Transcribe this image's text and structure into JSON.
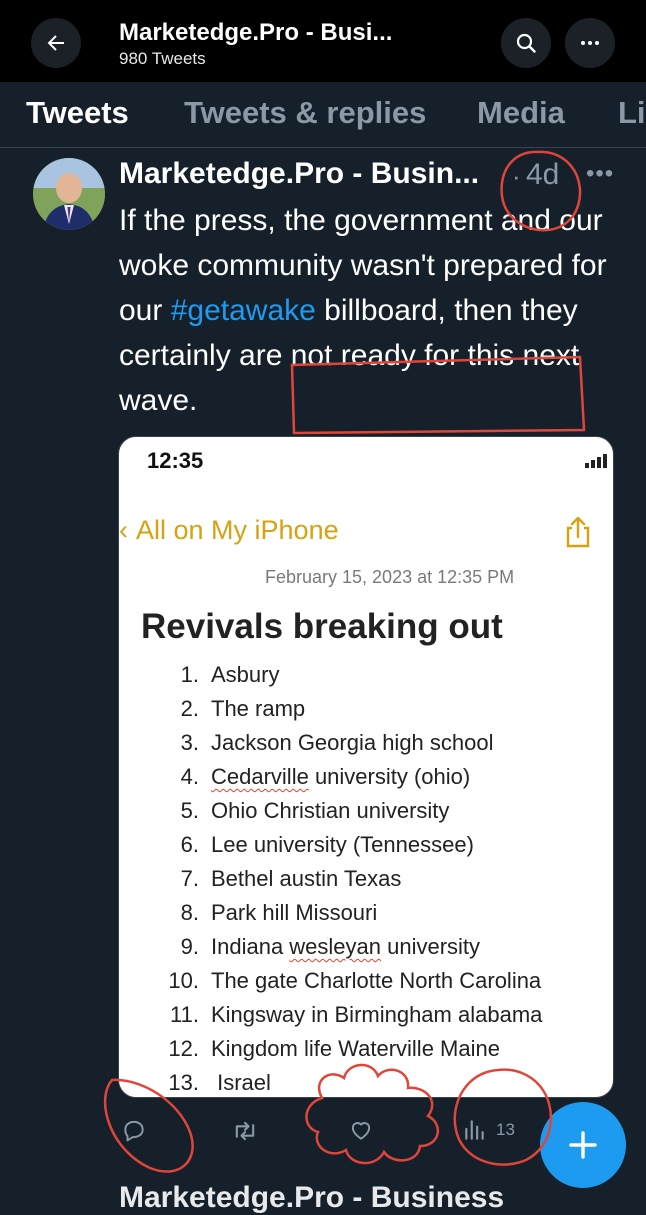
{
  "header": {
    "title": "Marketedge.Pro - Busi...",
    "subtitle": "980 Tweets"
  },
  "tabs": [
    {
      "label": "Tweets",
      "active": true
    },
    {
      "label": "Tweets & replies",
      "active": false
    },
    {
      "label": "Media",
      "active": false
    },
    {
      "label": "Li",
      "active": false
    }
  ],
  "tweet": {
    "author": "Marketedge.Pro - Busin...",
    "separator": "·",
    "time": "4d",
    "text_before": "If the press, the government and our woke community wasn't prepared for our ",
    "hashtag": "#getawake",
    "text_after": " billboard, then they certainly are not ready for this next wave.",
    "views": "13"
  },
  "media": {
    "status_time": "12:35",
    "back_label": "All on My iPhone",
    "date": "February 15, 2023 at 12:35 PM",
    "title": "Revivals breaking out",
    "items": [
      {
        "num": "1.",
        "text": "Asbury"
      },
      {
        "num": "2.",
        "text": "The ramp"
      },
      {
        "num": "3.",
        "text": "Jackson Georgia high school"
      },
      {
        "num": "4.",
        "pre": "",
        "squiggle": "Cedarville",
        "post": " university (ohio)"
      },
      {
        "num": "5.",
        "text": "Ohio Christian university"
      },
      {
        "num": "6.",
        "text": "Lee university (Tennessee)"
      },
      {
        "num": "7.",
        "text": "Bethel austin Texas"
      },
      {
        "num": "8.",
        "text": "Park hill Missouri"
      },
      {
        "num": "9.",
        "pre": "Indiana ",
        "squiggle": "wesleyan",
        "post": " university"
      },
      {
        "num": "10.",
        "text": "The gate Charlotte North Carolina"
      },
      {
        "num": "11.",
        "text": "Kingsway in Birmingham alabama"
      },
      {
        "num": "12.",
        "text": "Kingdom life Waterville Maine"
      },
      {
        "num": "13.",
        "text": " Israel"
      }
    ]
  },
  "next_tweet_author": "Marketedge.Pro - Business",
  "colors": {
    "background": "#15202b",
    "accent": "#1d9bf0",
    "secondary_text": "#8b98a5",
    "annotation": "#e0453a",
    "notes_accent": "#d6a20f"
  },
  "icons": {
    "back": "arrow-left-icon",
    "search": "search-icon",
    "more": "more-horizontal-icon",
    "reply": "reply-icon",
    "retweet": "retweet-icon",
    "like": "heart-icon",
    "views": "views-chart-icon",
    "compose": "plus-icon"
  }
}
